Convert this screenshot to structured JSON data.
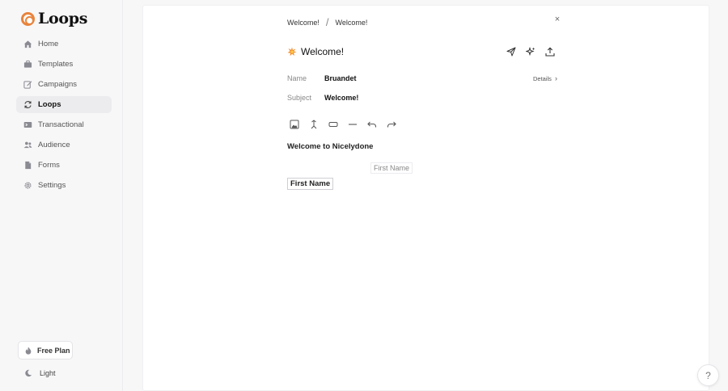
{
  "app": {
    "name": "Loops"
  },
  "sidebar": {
    "items": [
      {
        "label": "Home",
        "icon": "home-icon"
      },
      {
        "label": "Templates",
        "icon": "briefcase-icon"
      },
      {
        "label": "Campaigns",
        "icon": "pencil-icon"
      },
      {
        "label": "Loops",
        "icon": "refresh-icon",
        "active": true
      },
      {
        "label": "Transactional",
        "icon": "card-icon"
      },
      {
        "label": "Audience",
        "icon": "users-icon"
      },
      {
        "label": "Forms",
        "icon": "document-icon"
      },
      {
        "label": "Settings",
        "icon": "gear-icon"
      }
    ],
    "plan_label": "Free Plan",
    "theme_label": "Light"
  },
  "breadcrumb": {
    "first": "Welcome!",
    "separator": "/",
    "second": "Welcome!"
  },
  "header": {
    "title": "Welcome!",
    "close_glyph": "×"
  },
  "fields": {
    "name_label": "Name",
    "name_value": "Bruandet",
    "subject_label": "Subject",
    "subject_value": "Welcome!",
    "details_label": "Details",
    "details_chevron": "›"
  },
  "editor": {
    "heading": "Welcome to Nicelydone",
    "placeholder_tag": "First Name",
    "selected_tag": "First Name"
  },
  "help": {
    "glyph": "?"
  },
  "colors": {
    "accent": "#e8843c",
    "active_bg": "#ececee"
  }
}
